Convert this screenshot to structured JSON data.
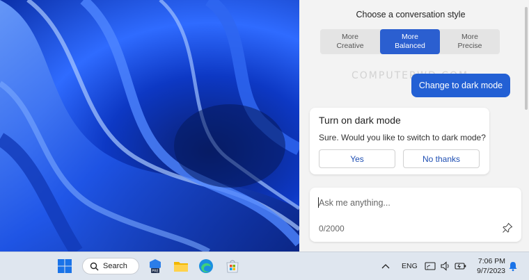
{
  "copilot": {
    "style_title": "Choose a conversation style",
    "styles": [
      {
        "line1": "More",
        "line2": "Creative",
        "active": false
      },
      {
        "line1": "More",
        "line2": "Balanced",
        "active": true
      },
      {
        "line1": "More",
        "line2": "Precise",
        "active": false
      }
    ],
    "watermark": "COMPUTERWD.COM",
    "user_message": "Change to dark mode",
    "card": {
      "title": "Turn on dark mode",
      "text": "Sure. Would you like to switch to dark mode?",
      "yes_label": "Yes",
      "no_label": "No thanks"
    },
    "input": {
      "placeholder": "Ask me anything...",
      "counter": "0/2000"
    }
  },
  "taskbar": {
    "search_label": "Search",
    "language": "ENG",
    "time": "7:06 PM",
    "date": "9/7/2023",
    "pinned_icons": [
      "windows-start-icon",
      "search-icon",
      "pre-release-app-icon",
      "file-explorer-icon",
      "edge-icon",
      "microsoft-store-icon"
    ],
    "tray_icons": [
      "chevron-up-icon",
      "wifi-display-icon",
      "volume-icon",
      "battery-icon",
      "notification-bell-icon"
    ]
  },
  "colors": {
    "accent": "#2360d4",
    "panel_bg": "#f3f3f3",
    "taskbar_bg": "#dfe6ef"
  }
}
